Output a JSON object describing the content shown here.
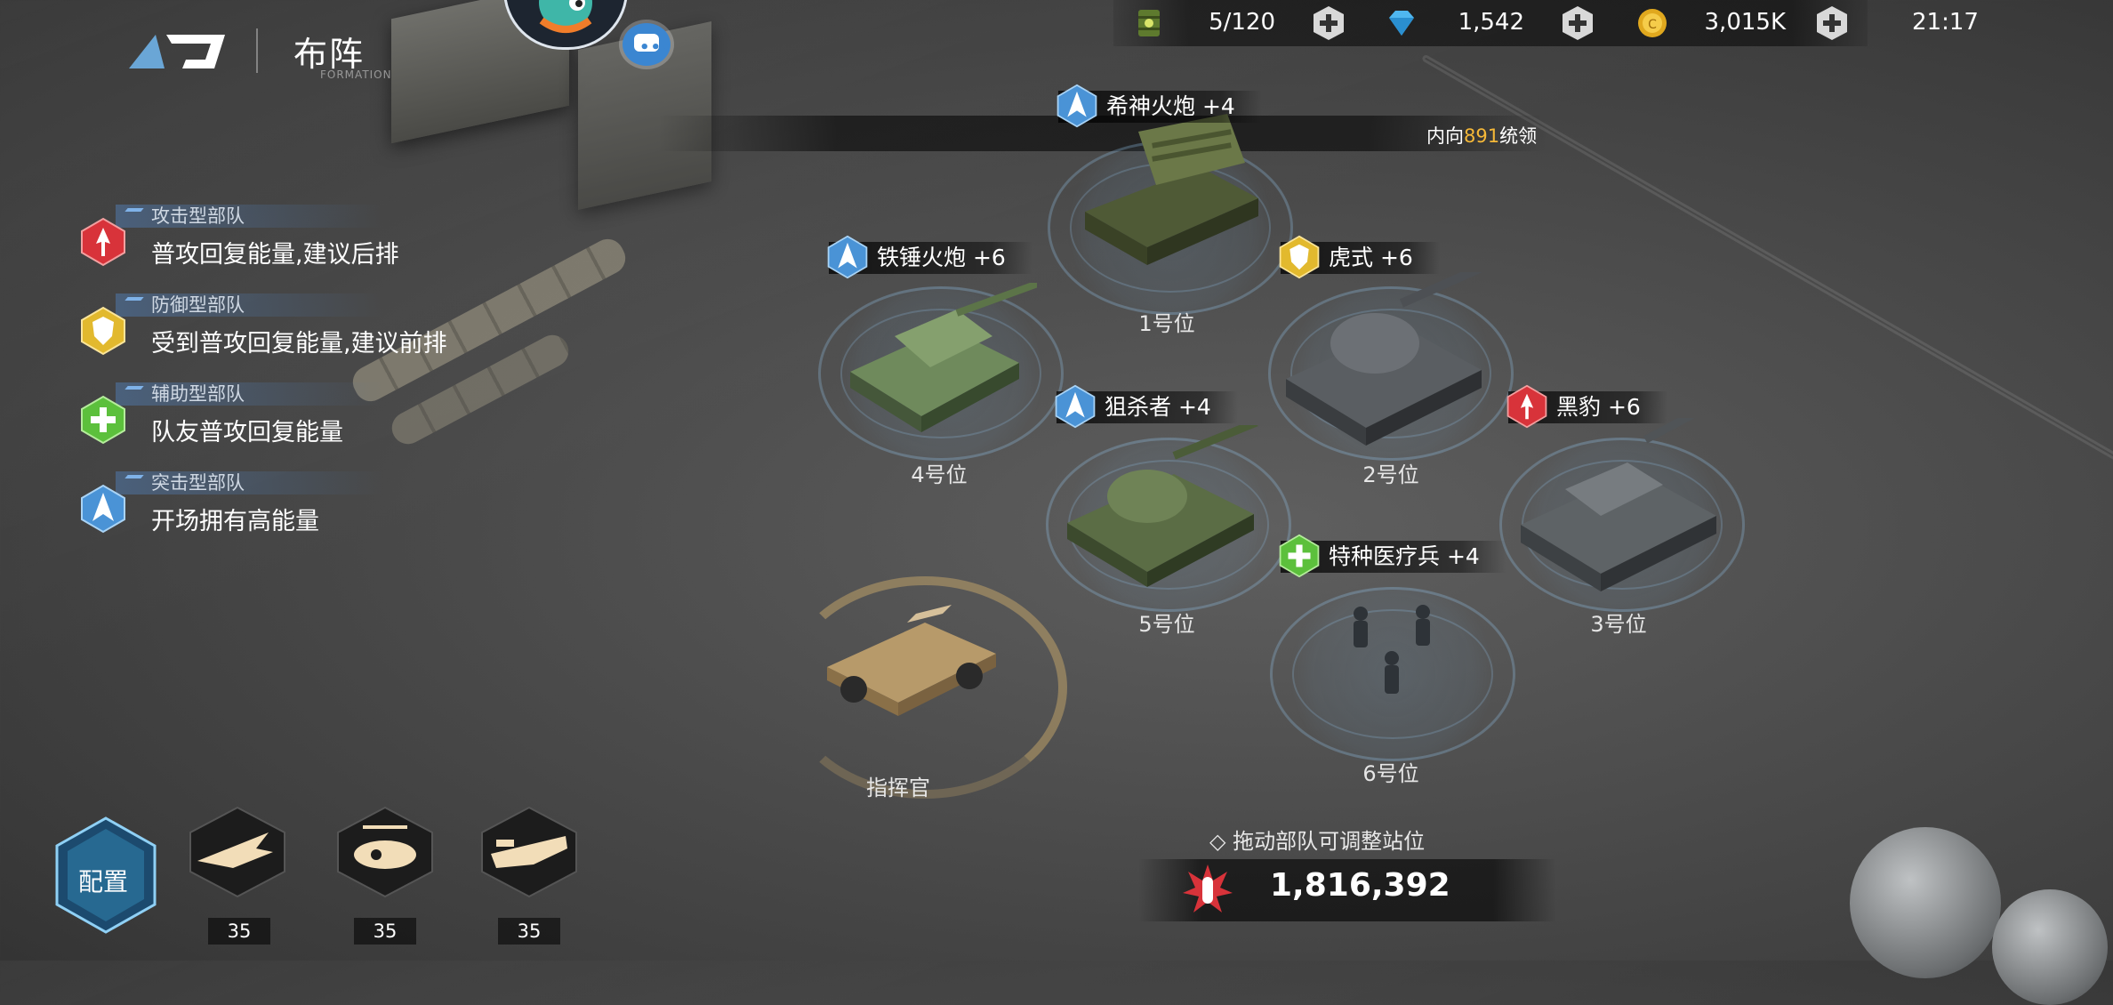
{
  "header": {
    "title": "布阵",
    "subtitle": "FORMATION"
  },
  "resources": [
    {
      "icon": "fuel-barrel-icon",
      "value": "5/120"
    },
    {
      "icon": "diamond-icon",
      "value": "1,542"
    },
    {
      "icon": "gold-coin-icon",
      "value": "3,015K"
    }
  ],
  "clock": "21:17",
  "command": {
    "prefix": "内向",
    "value": "891",
    "suffix": "统领"
  },
  "legend": [
    {
      "tag": "攻击型部队",
      "desc": "普攻回复能量,建议后排",
      "role": "attack",
      "color": "#d8333a"
    },
    {
      "tag": "防御型部队",
      "desc": "受到普攻回复能量,建议前排",
      "role": "defense",
      "color": "#e2b92e"
    },
    {
      "tag": "辅助型部队",
      "desc": "队友普攻回复能量",
      "role": "support",
      "color": "#5cc03c"
    },
    {
      "tag": "突击型部队",
      "desc": "开场拥有高能量",
      "role": "assault",
      "color": "#4a93d6"
    }
  ],
  "units": [
    {
      "name": "希神火炮 +4",
      "slot": "1号位",
      "role": "assault"
    },
    {
      "name": "虎式 +6",
      "slot": "2号位",
      "role": "defense"
    },
    {
      "name": "黑豹 +6",
      "slot": "3号位",
      "role": "attack"
    },
    {
      "name": "铁锤火炮 +6",
      "slot": "4号位",
      "role": "assault"
    },
    {
      "name": "狙杀者 +4",
      "slot": "5号位",
      "role": "assault"
    },
    {
      "name": "特种医疗兵 +4",
      "slot": "6号位",
      "role": "support"
    }
  ],
  "commander_label": "指挥官",
  "hint": "拖动部队可调整站位",
  "power": "1,816,392",
  "config_label": "配置",
  "skills": [
    {
      "icon": "aircraft-skill-icon",
      "count": "35"
    },
    {
      "icon": "helicopter-skill-icon",
      "count": "35"
    },
    {
      "icon": "bomber-skill-icon",
      "count": "35"
    }
  ]
}
